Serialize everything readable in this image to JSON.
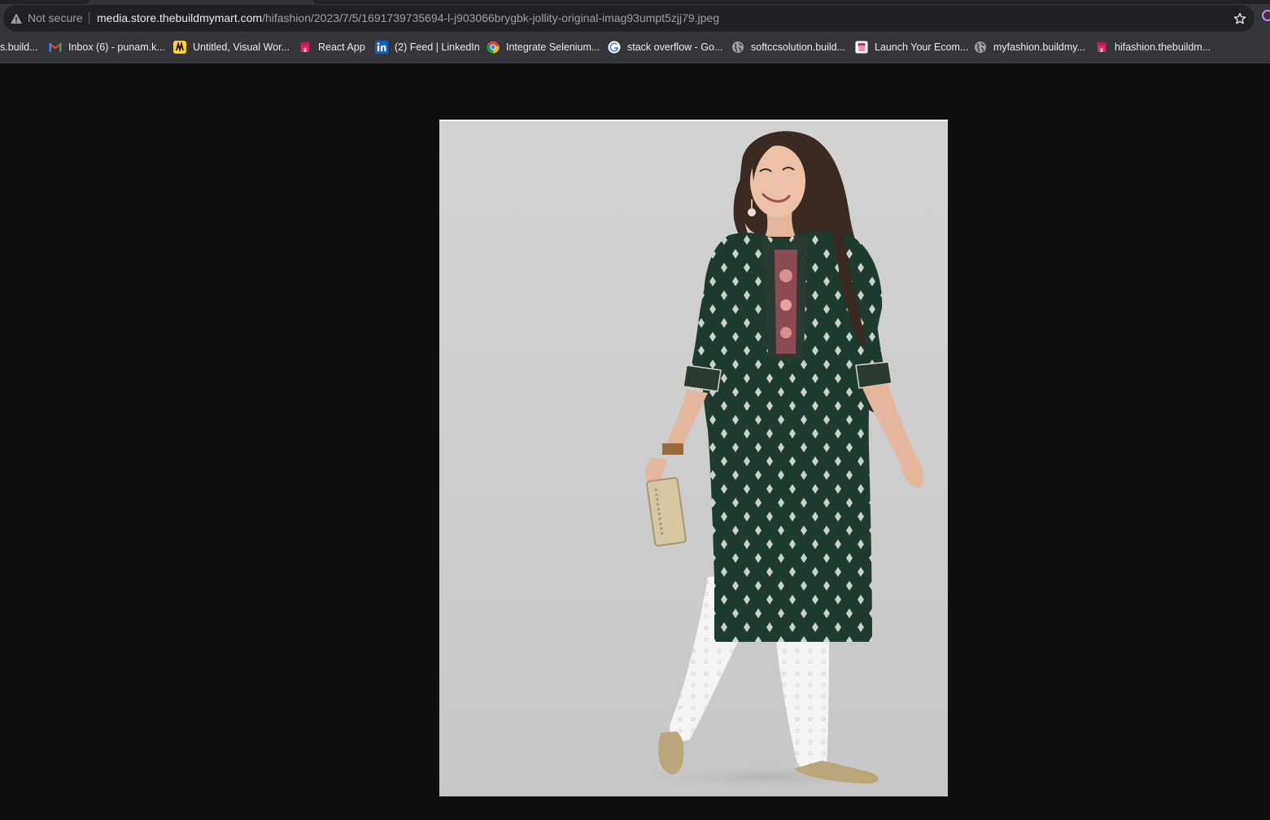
{
  "browser": {
    "security_label": "Not secure",
    "url_host": "media.store.thebuildmymart.com",
    "url_path": "/hifashion/2023/7/5/1691739735694-l-j903066brygbk-jollity-original-imag93umpt5zjj79.jpeg",
    "icons": {
      "security": "warning-triangle-icon",
      "bookmark": "star-icon"
    }
  },
  "bookmarks": [
    {
      "label": "s.build...",
      "icon": "none"
    },
    {
      "label": "Inbox (6) - punam.k...",
      "icon": "gmail-icon"
    },
    {
      "label": "Untitled, Visual Wor...",
      "icon": "miro-icon"
    },
    {
      "label": "React App",
      "icon": "store-icon"
    },
    {
      "label": "(2) Feed | LinkedIn",
      "icon": "linkedin-icon"
    },
    {
      "label": "Integrate Selenium...",
      "icon": "chrome-icon"
    },
    {
      "label": "stack overflow - Go...",
      "icon": "google-icon"
    },
    {
      "label": "softccsolution.build...",
      "icon": "globe-icon"
    },
    {
      "label": "Launch Your Ecom...",
      "icon": "store-icon"
    },
    {
      "label": "myfashion.buildmy...",
      "icon": "globe-icon"
    },
    {
      "label": "hifashion.thebuildm...",
      "icon": "store-icon"
    }
  ],
  "colors": {
    "chrome": "#35363a",
    "omnibox": "#202124",
    "viewer_background": "#0e0e0e",
    "kurta": "#1f3a2e",
    "salwar": "#f4f4f4"
  }
}
